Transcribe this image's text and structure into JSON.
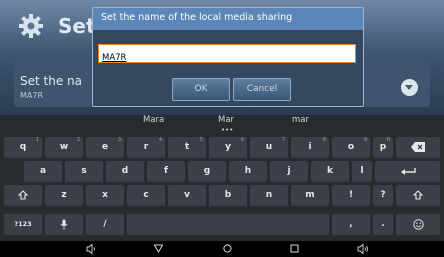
{
  "background": {
    "title": "Sett",
    "row_title": "Set the na",
    "row_value": "MA7R"
  },
  "dialog": {
    "title": "Set the name of the local media sharing",
    "input_value": "MA7R",
    "ok_label": "OK",
    "cancel_label": "Cancel"
  },
  "keyboard": {
    "suggestions": [
      "Mara",
      "Mar",
      "mar"
    ],
    "suggestion_dots": "•••",
    "rows": [
      [
        "q",
        "w",
        "e",
        "r",
        "t",
        "y",
        "u",
        "i",
        "o",
        "p"
      ],
      [
        "a",
        "s",
        "d",
        "f",
        "g",
        "h",
        "j",
        "k",
        "l"
      ],
      [
        "z",
        "x",
        "c",
        "v",
        "b",
        "n",
        "m",
        "!",
        "?"
      ]
    ],
    "hints": [
      "1",
      "2",
      "3",
      "4",
      "5",
      "6",
      "7",
      "8",
      "9",
      "0"
    ],
    "symbols_label": "?123",
    "slash_label": "/",
    "comma_label": ",",
    "period_label": "."
  },
  "icons": {
    "settings": "gear-icon",
    "backspace": "backspace-icon",
    "enter": "enter-icon",
    "shift": "shift-icon",
    "mic": "mic-icon",
    "emoji": "emoji-icon",
    "back": "back-icon",
    "home": "home-icon",
    "recent": "recent-apps-icon",
    "volume_down": "volume-down-icon",
    "volume_up": "volume-up-icon"
  },
  "colors": {
    "dialog_header": "#5b86b7",
    "input_border": "#e08a2a",
    "keyboard_bg": "#272b30",
    "key_bg": "#3b4047"
  }
}
